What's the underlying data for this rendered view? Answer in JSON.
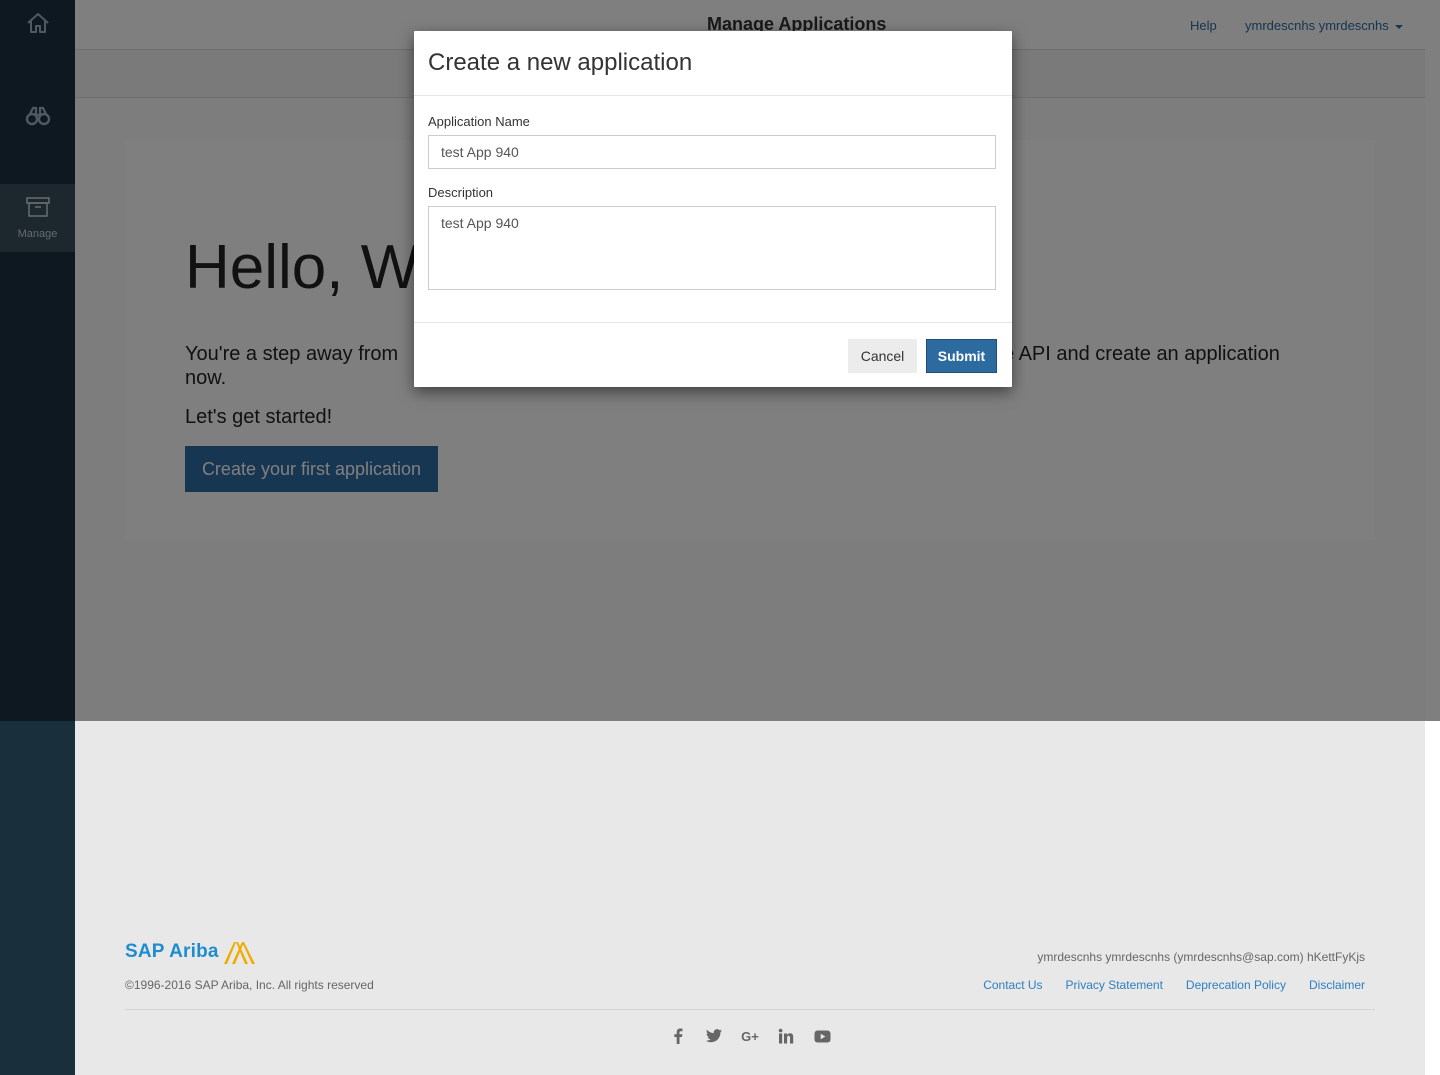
{
  "sidebar": {
    "items": [
      {
        "icon": "home-icon",
        "label": ""
      },
      {
        "icon": "binoculars-icon",
        "label": ""
      },
      {
        "icon": "archive-box-icon",
        "label": "Manage"
      }
    ]
  },
  "topbar": {
    "title": "Manage Applications",
    "help": "Help",
    "user": "ymrdescnhs ymrdescnhs"
  },
  "hero": {
    "title": "Hello, W",
    "text_left": "You're a step away from",
    "text_right": "e API and create an application",
    "text_end": "now.",
    "start": "Let's get started!",
    "button": "Create your first application"
  },
  "modal": {
    "title": "Create a new application",
    "name_label": "Application Name",
    "name_value": "test App 940",
    "desc_label": "Description",
    "desc_value": "test App 940",
    "cancel": "Cancel",
    "submit": "Submit"
  },
  "footer": {
    "brand": "SAP Ariba",
    "copyright": "©1996-2016 SAP Ariba, Inc. All rights reserved",
    "user_info": "ymrdescnhs ymrdescnhs (ymrdescnhs@sap.com) hKettFyKjs",
    "links": [
      "Contact Us",
      "Privacy Statement",
      "Deprecation Policy",
      "Disclaimer"
    ],
    "social": [
      "facebook-icon",
      "twitter-icon",
      "google-plus-icon",
      "linkedin-icon",
      "youtube-icon"
    ]
  },
  "colors": {
    "sidebar": "#1a3140",
    "primary": "#2e6da4",
    "link": "#2d7fc1",
    "brand_blue": "#1d8dcf",
    "brand_gold": "#f0ab00"
  }
}
